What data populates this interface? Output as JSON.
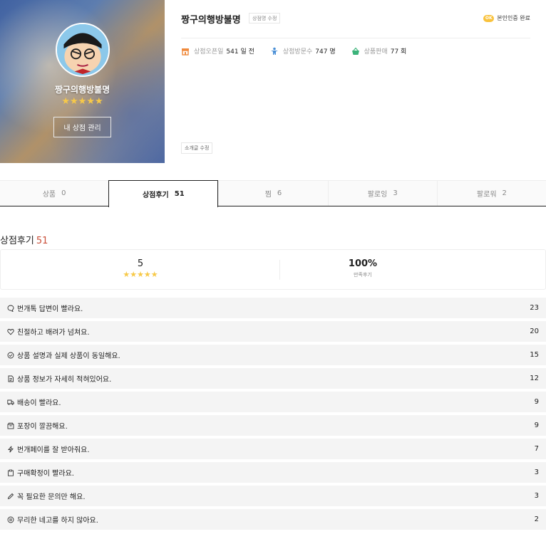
{
  "profile": {
    "name": "짱구의행방불명",
    "stars": "★★★★★",
    "manage_label": "내 상점 관리"
  },
  "shop": {
    "title": "짱구의행방불명",
    "edit_name_label": "상점명 수정",
    "verify_badge": "OK",
    "verify_label": "본인인증 완료",
    "stats": [
      {
        "label": "상점오픈일",
        "value": "541 일 전",
        "icon": "store-icon"
      },
      {
        "label": "상점방문수",
        "value": "747 명",
        "icon": "visitor-icon"
      },
      {
        "label": "상품판매",
        "value": "77 회",
        "icon": "basket-icon"
      }
    ],
    "edit_intro_label": "소개글 수정"
  },
  "tabs": [
    {
      "label": "상품",
      "count": "0"
    },
    {
      "label": "상점후기",
      "count": "51"
    },
    {
      "label": "찜",
      "count": "6"
    },
    {
      "label": "팔로잉",
      "count": "3"
    },
    {
      "label": "팔로워",
      "count": "2"
    }
  ],
  "active_tab": 1,
  "reviews": {
    "title": "상점후기",
    "count": "51",
    "score": "5",
    "score_stars": "★★★★★",
    "satisfaction": "100%",
    "satisfaction_label": "만족후기",
    "items": [
      {
        "text": "번개톡 답변이 빨라요.",
        "count": "23",
        "icon": "chat-bubble-icon"
      },
      {
        "text": "친절하고 배려가 넘쳐요.",
        "count": "20",
        "icon": "heart-icon"
      },
      {
        "text": "상품 설명과 실제 상품이 동일해요.",
        "count": "15",
        "icon": "check-circle-icon"
      },
      {
        "text": "상품 정보가 자세히 적혀있어요.",
        "count": "12",
        "icon": "document-icon"
      },
      {
        "text": "배송이 빨라요.",
        "count": "9",
        "icon": "truck-icon"
      },
      {
        "text": "포장이 깔끔해요.",
        "count": "9",
        "icon": "box-icon"
      },
      {
        "text": "번개페이를 잘 받아줘요.",
        "count": "7",
        "icon": "lightning-icon"
      },
      {
        "text": "구매확정이 빨라요.",
        "count": "3",
        "icon": "clipboard-icon"
      },
      {
        "text": "꼭 필요한 문의만 해요.",
        "count": "3",
        "icon": "pencil-icon"
      },
      {
        "text": "무리한 네고를 하지 않아요.",
        "count": "2",
        "icon": "no-negotiation-icon"
      }
    ]
  },
  "colors": {
    "accent_red": "#c94f39",
    "star_yellow": "#f7c948",
    "ok_yellow": "#f9c23c",
    "row_bg": "#f4f4f4"
  }
}
